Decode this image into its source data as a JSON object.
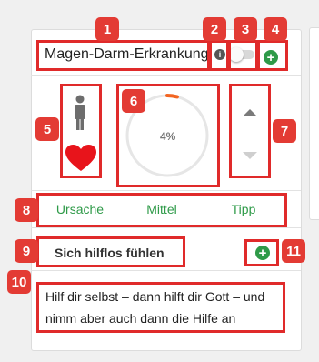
{
  "header": {
    "title": "Magen-Darm-Erkrankung",
    "info_icon": "i",
    "toggle_on": false,
    "add_icon": "+"
  },
  "status": {
    "progress_label": "4%",
    "progress_fraction": 0.04
  },
  "tabs": [
    {
      "label": "Ursache"
    },
    {
      "label": "Mittel"
    },
    {
      "label": "Tipp"
    }
  ],
  "feeling": {
    "label": "Sich hilflos fühlen",
    "add_icon": "+"
  },
  "tip": {
    "text": "Hilf dir selbst – dann hilft dir Gott – und nimm aber auch dann die Hilfe an"
  },
  "annotations": [
    "1",
    "2",
    "3",
    "4",
    "5",
    "6",
    "7",
    "8",
    "9",
    "10",
    "11"
  ],
  "colors": {
    "accent_green": "#2e9a48",
    "annotation_red": "#e02a2a",
    "heart_red": "#e8141b",
    "progress_orange": "#f26522"
  }
}
